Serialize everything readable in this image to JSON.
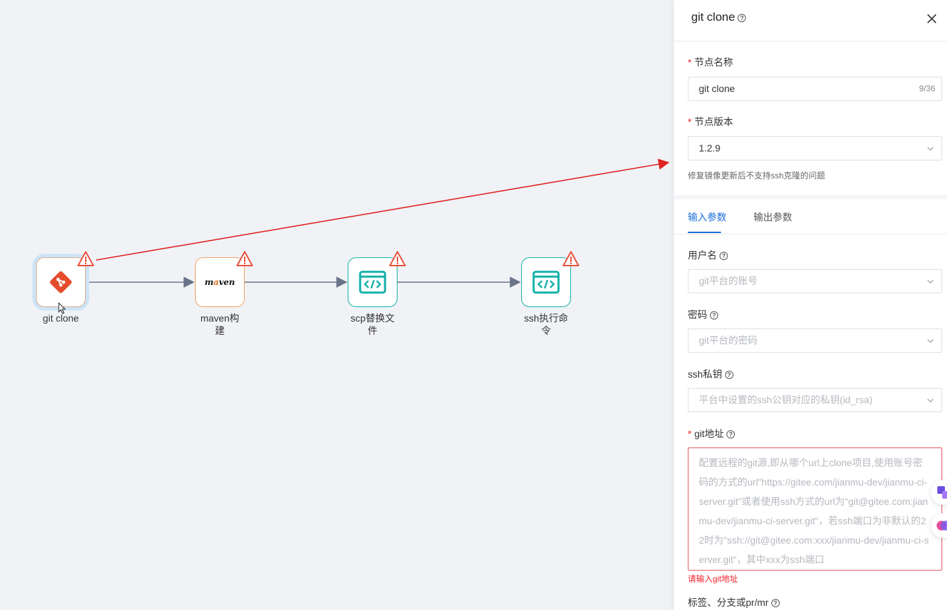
{
  "nodes": [
    {
      "name": "git clone",
      "icon": "git-icon"
    },
    {
      "name": "maven构\n建",
      "icon": "maven-logo"
    },
    {
      "name": "scp替换文\n件",
      "icon": "code-window-icon"
    },
    {
      "name": "ssh执行命\n令",
      "icon": "code-window-icon"
    }
  ],
  "maven_logo": {
    "pre": "m",
    "a": "a",
    "post": "ven"
  },
  "panel": {
    "title": "git clone",
    "node_name": {
      "label": "节点名称",
      "value": "git clone",
      "count": "9/36"
    },
    "node_version": {
      "label": "节点版本",
      "value": "1.2.9",
      "hint": "修复镜像更新后不支持ssh克隆的问题"
    },
    "tabs": [
      {
        "label": "输入参数",
        "active": true
      },
      {
        "label": "输出参数",
        "active": false
      }
    ],
    "username": {
      "label": "用户名",
      "placeholder": "git平台的账号"
    },
    "password": {
      "label": "密码",
      "placeholder": "git平台的密码"
    },
    "ssh_key": {
      "label": "ssh私钥",
      "placeholder": "平台中设置的ssh公钥对应的私钥(id_rsa)"
    },
    "git_url": {
      "label": "git地址",
      "placeholder": "配置远程的git源,即从哪个url上clone项目,使用账号密码的方式的url\"https://gitee.com/jianmu-dev/jianmu-ci-server.git\"或者使用ssh方式的url为\"git@gitee.com:jianmu-dev/jianmu-ci-server.git\"，若ssh端口为非默认的22时为\"ssh://git@gitee.com:xxx/jianmu-dev/jianmu-ci-server.git\"，其中xxx为ssh端口",
      "error": "请输入git地址"
    },
    "ref": {
      "label": "标签、分支或pr/mr"
    }
  },
  "colors": {
    "accent": "#1b6fd8",
    "error": "#f5222d",
    "git": "#e44c2c",
    "teal": "#12b0a8",
    "warn": "#e8503a"
  }
}
